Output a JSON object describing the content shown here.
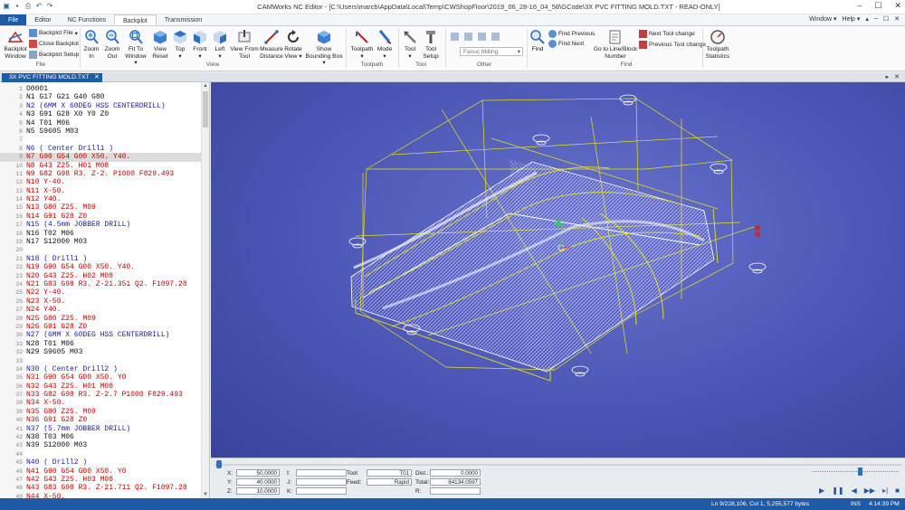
{
  "window": {
    "title": "CAMWorks NC Editor - [C:\\Users\\marcb\\AppData\\Local\\Temp\\CWShopFloor\\2019_06_28-16_04_58\\GCode\\3X PVC FITTING MOLD.TXT - READ-ONLY]",
    "menu_window": "Window",
    "menu_help": "Help",
    "minimize": "–",
    "maximize": "☐",
    "close": "✕"
  },
  "tabs": [
    "File",
    "Editor",
    "NC Functions",
    "Backplot",
    "Transmission"
  ],
  "ribbon": {
    "backplot_window": "Backplot\nWindow",
    "backplot_file": "Backplot File",
    "close_backplot": "Close Backplot",
    "backplot_setup": "Backplot Setup",
    "zoom_in": "Zoom\nIn",
    "zoom_out": "Zoom\nOut",
    "fit_to_window": "Fit To\nWindow",
    "view_reset": "View\nReset",
    "top": "Top",
    "front": "Front",
    "left": "Left",
    "view_from_tool": "View From\nTool",
    "measure_distance": "Measure\nDistance",
    "rotate_view": "Rotate\nView",
    "show_bounding_box": "Show\nBounding Box",
    "toolpath": "Toolpath",
    "mode": "Mode",
    "tool": "Tool",
    "tool_setup": "Tool\nSetup",
    "controller": "Fanuc Milling",
    "find": "Find",
    "find_previous": "Find Previous",
    "find_next": "Find Next",
    "goto_line": "Go to Line/Block\nNumber",
    "next_tool_change": "Next Tool change",
    "previous_tool_change": "Previous Tool change",
    "toolpath_statistics": "Toolpath\nStatistics",
    "groups": {
      "file": "File",
      "view": "View",
      "toolpath": "Toolpath",
      "tool": "Tool",
      "other": "Other",
      "find": "Find"
    }
  },
  "document_tab": "3X PVC FITTING MOLD.TXT",
  "editor": {
    "lines": [
      {
        "n": "1",
        "text": "O0001",
        "color": "black"
      },
      {
        "n": "2",
        "text": "N1 G17 G21 G40 G80",
        "color": "black"
      },
      {
        "n": "3",
        "text": "N2 (6MM X 60DEG HSS CENTERDRILL)",
        "color": "blue"
      },
      {
        "n": "4",
        "text": "N3 G91 G28 X0 Y0 Z0",
        "color": "black"
      },
      {
        "n": "5",
        "text": "N4 T01 M06",
        "color": "black"
      },
      {
        "n": "6",
        "text": "N5 S9605 M03",
        "color": "black"
      },
      {
        "n": "7",
        "text": "",
        "color": "black"
      },
      {
        "n": "8",
        "text": "N6 ( Center Drill1 )",
        "color": "blue"
      },
      {
        "n": "9",
        "text": "N7 G90 G54 G00 X50. Y40.",
        "color": "red",
        "highlight": true
      },
      {
        "n": "10",
        "text": "N8 G43 Z25. H01 M08",
        "color": "red"
      },
      {
        "n": "11",
        "text": "N9 G82 G98 R3. Z-2. P1000 F829.493",
        "color": "red"
      },
      {
        "n": "12",
        "text": "N10 Y-40.",
        "color": "red"
      },
      {
        "n": "13",
        "text": "N11 X-50.",
        "color": "red"
      },
      {
        "n": "14",
        "text": "N12 Y40.",
        "color": "red"
      },
      {
        "n": "15",
        "text": "N13 G80 Z25. M09",
        "color": "red"
      },
      {
        "n": "16",
        "text": "N14 G91 G28 Z0",
        "color": "red"
      },
      {
        "n": "17",
        "text": "N15 (4.5mm JOBBER DRILL)",
        "color": "blue"
      },
      {
        "n": "18",
        "text": "N16 T02 M06",
        "color": "black"
      },
      {
        "n": "19",
        "text": "N17 S12000 M03",
        "color": "black"
      },
      {
        "n": "20",
        "text": "",
        "color": "black"
      },
      {
        "n": "21",
        "text": "N18 ( Drill1 )",
        "color": "blue"
      },
      {
        "n": "22",
        "text": "N19 G90 G54 G00 X50. Y40.",
        "color": "red"
      },
      {
        "n": "23",
        "text": "N20 G43 Z25. H02 M08",
        "color": "red"
      },
      {
        "n": "24",
        "text": "N21 G83 G98 R3. Z-21.351 Q2. F1097.28",
        "color": "red"
      },
      {
        "n": "25",
        "text": "N22 Y-40.",
        "color": "red"
      },
      {
        "n": "26",
        "text": "N23 X-50.",
        "color": "red"
      },
      {
        "n": "27",
        "text": "N24 Y40.",
        "color": "red"
      },
      {
        "n": "28",
        "text": "N25 G80 Z25. M09",
        "color": "red"
      },
      {
        "n": "29",
        "text": "N26 G91 G28 Z0",
        "color": "red"
      },
      {
        "n": "30",
        "text": "N27 (6MM X 60DEG HSS CENTERDRILL)",
        "color": "blue"
      },
      {
        "n": "31",
        "text": "N28 T01 M06",
        "color": "black"
      },
      {
        "n": "32",
        "text": "N29 S9605 M03",
        "color": "black"
      },
      {
        "n": "33",
        "text": "",
        "color": "black"
      },
      {
        "n": "34",
        "text": "N30 ( Center Drill2 )",
        "color": "blue"
      },
      {
        "n": "35",
        "text": "N31 G90 G54 G00 X50. Y0",
        "color": "red"
      },
      {
        "n": "36",
        "text": "N32 G43 Z25. H01 M08",
        "color": "red"
      },
      {
        "n": "37",
        "text": "N33 G82 G98 R3. Z-2.7 P1000 F829.493",
        "color": "red"
      },
      {
        "n": "38",
        "text": "N34 X-50.",
        "color": "red"
      },
      {
        "n": "39",
        "text": "N35 G80 Z25. M09",
        "color": "red"
      },
      {
        "n": "40",
        "text": "N36 G91 G28 Z0",
        "color": "red"
      },
      {
        "n": "41",
        "text": "N37 (5.7mm JOBBER DRILL)",
        "color": "blue"
      },
      {
        "n": "42",
        "text": "N38 T03 M06",
        "color": "black"
      },
      {
        "n": "43",
        "text": "N39 S12000 M03",
        "color": "black"
      },
      {
        "n": "44",
        "text": "",
        "color": "black"
      },
      {
        "n": "45",
        "text": "N40 ( Drill2 )",
        "color": "blue"
      },
      {
        "n": "46",
        "text": "N41 G90 G54 G00 X50. Y0",
        "color": "red"
      },
      {
        "n": "47",
        "text": "N42 G43 Z25. H03 M08",
        "color": "red"
      },
      {
        "n": "48",
        "text": "N43 G83 G98 R3. Z-21.711 Q2. F1097.28",
        "color": "red"
      },
      {
        "n": "49",
        "text": "N44 X-50.",
        "color": "red"
      }
    ]
  },
  "backplot": {
    "x_label": "X:",
    "x_value": "50.0000",
    "y_label": "Y:",
    "y_value": "40.0000",
    "z_label": "Z:",
    "z_value": "10.0000",
    "i_label": "I:",
    "j_label": "J:",
    "k_label": "K:",
    "tool_label": "Tool:",
    "tool_value": "T01",
    "feed_label": "Feed:",
    "feed_value": "Rapid",
    "dist_label": "Dist.:",
    "dist_value": "0.0000",
    "total_label": "Total:",
    "total_value": "84134.0597",
    "r_label": "R:"
  },
  "status": {
    "position": "Ln 9/228,106, Col 1, 5,255,577 bytes",
    "mode": "INS",
    "time": "4:14:39 PM"
  },
  "colors": {
    "accent": "#1f5aa6",
    "viewport": "#4b55b4",
    "toolpath": "#e8e21a",
    "mesh": "#ffffff",
    "code_red": "#c00000",
    "code_blue": "#1a1aa8"
  }
}
